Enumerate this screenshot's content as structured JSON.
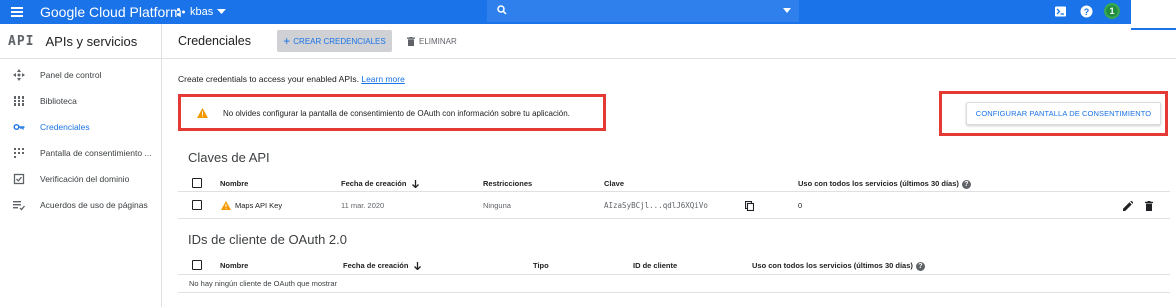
{
  "topbar": {
    "app_title": "Google Cloud Platform",
    "project": "kbas",
    "notifications_count": "1"
  },
  "sidebar": {
    "api_logo": "API",
    "title": "APIs y servicios",
    "items": [
      {
        "label": "Panel de control",
        "icon": "dashboard-icon"
      },
      {
        "label": "Biblioteca",
        "icon": "library-icon"
      },
      {
        "label": "Credenciales",
        "icon": "key-icon",
        "active": true
      },
      {
        "label": "Pantalla de consentimiento ...",
        "icon": "consent-icon"
      },
      {
        "label": "Verificación del dominio",
        "icon": "domain-check-icon"
      },
      {
        "label": "Acuerdos de uso de páginas",
        "icon": "page-agreement-icon"
      }
    ]
  },
  "header": {
    "title": "Credenciales",
    "create_label": "CREAR CREDENCIALES",
    "delete_label": "ELIMINAR"
  },
  "info": {
    "text": "Create credentials to access your enabled APIs.",
    "link": "Learn more"
  },
  "warning": {
    "text": "No olvides configurar la pantalla de consentimiento de OAuth con información sobre tu aplicación."
  },
  "consent_button": "CONFIGURAR PANTALLA DE CONSENTIMIENTO",
  "api_keys": {
    "title": "Claves de API",
    "columns": [
      "Nombre",
      "Fecha de creación",
      "Restricciones",
      "Clave",
      "Uso con todos los servicios (últimos 30 días)"
    ],
    "rows": [
      {
        "name": "Maps API Key",
        "date": "11 mar. 2020",
        "restrictions": "Ninguna",
        "key": "AIzaSyBCjl...qdlJ6XQiVo",
        "usage": "0"
      }
    ]
  },
  "oauth": {
    "title": "IDs de cliente de OAuth 2.0",
    "columns": [
      "Nombre",
      "Fecha de creación",
      "Tipo",
      "ID de cliente",
      "Uso con todos los servicios (últimos 30 días)"
    ],
    "empty": "No hay ningún cliente de OAuth que mostrar"
  },
  "colors": {
    "topbar": "#1a73e8",
    "accent": "#1a73e8",
    "warning_border": "#e53935",
    "warning_icon": "#f29900"
  }
}
